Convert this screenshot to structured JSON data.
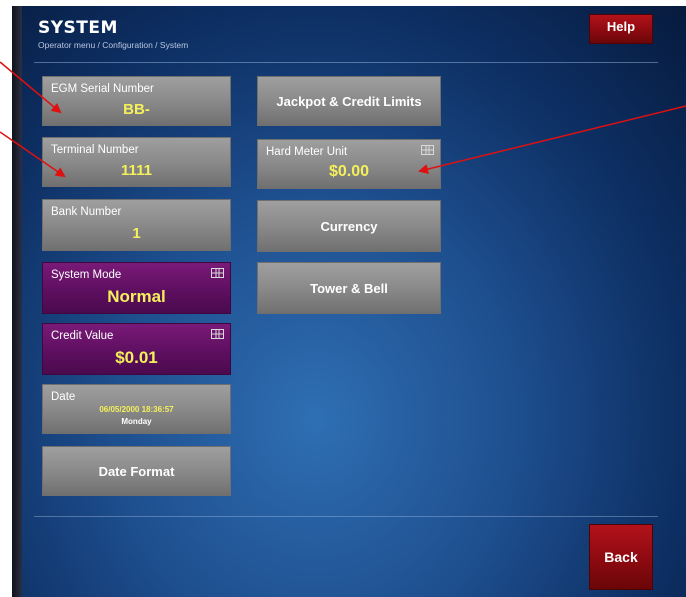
{
  "header": {
    "title": "SYSTEM",
    "breadcrumb": "Operator menu / Configuration / System"
  },
  "buttons": {
    "help": "Help",
    "back": "Back"
  },
  "left_tiles": [
    {
      "label": "EGM Serial Number",
      "value": "BB-"
    },
    {
      "label": "Terminal Number",
      "value": "1111"
    },
    {
      "label": "Bank Number",
      "value": "1"
    },
    {
      "label": "System Mode",
      "value": "Normal"
    },
    {
      "label": "Credit Value",
      "value": "$0.01"
    },
    {
      "label": "Date",
      "value": "06/05/2000 18:36:57",
      "day": "Monday"
    },
    {
      "label": "Date Format"
    }
  ],
  "right_tiles": [
    {
      "label": "Jackpot & Credit Limits"
    },
    {
      "label": "Hard Meter Unit",
      "value": "$0.00"
    },
    {
      "label": "Currency"
    },
    {
      "label": "Tower & Bell"
    }
  ],
  "colors": {
    "value_yellow": "#f4f05b",
    "purple_tile": "#5e0f60",
    "red_button": "#8c0a10",
    "annotation_arrow": "#e01010"
  }
}
